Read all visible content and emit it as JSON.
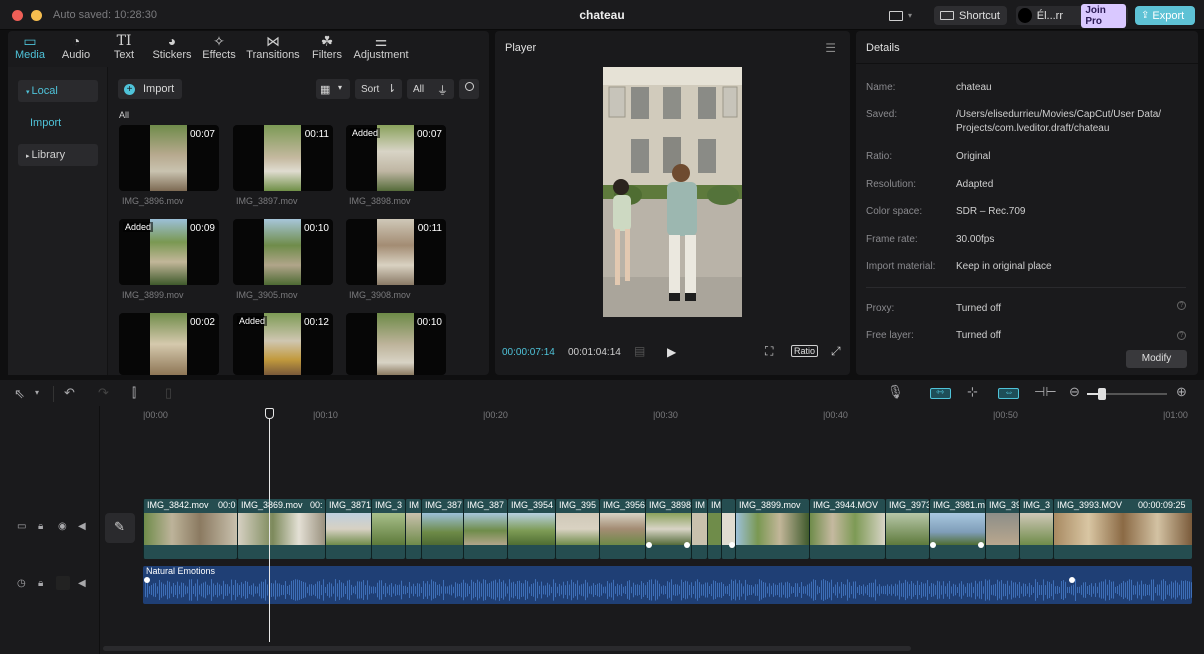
{
  "titlebar": {
    "autosave": "Auto saved: 10:28:30",
    "project": "chateau",
    "shortcut": "Shortcut",
    "account": "Él...rr",
    "join_pro": "Join Pro",
    "export": "Export"
  },
  "media_tabs": [
    {
      "label": "Media",
      "icon": "media-icon"
    },
    {
      "label": "Audio",
      "icon": "audio-icon"
    },
    {
      "label": "Text",
      "icon": "text-icon"
    },
    {
      "label": "Stickers",
      "icon": "stickers-icon"
    },
    {
      "label": "Effects",
      "icon": "effects-icon"
    },
    {
      "label": "Transitions",
      "icon": "transitions-icon"
    },
    {
      "label": "Filters",
      "icon": "filters-icon"
    },
    {
      "label": "Adjustment",
      "icon": "adjustment-icon"
    }
  ],
  "sidebar": {
    "local": "Local",
    "import": "Import",
    "library": "Library"
  },
  "media": {
    "import_label": "Import",
    "sort_label": "Sort",
    "all_filter": "All",
    "section_all": "All",
    "items": [
      {
        "name": "IMG_3896.mov",
        "duration": "00:07",
        "added": ""
      },
      {
        "name": "IMG_3897.mov",
        "duration": "00:11",
        "added": ""
      },
      {
        "name": "IMG_3898.mov",
        "duration": "00:07",
        "added": "Added"
      },
      {
        "name": "IMG_3899.mov",
        "duration": "00:09",
        "added": "Added"
      },
      {
        "name": "IMG_3905.mov",
        "duration": "00:10",
        "added": ""
      },
      {
        "name": "IMG_3908.mov",
        "duration": "00:11",
        "added": ""
      },
      {
        "name": "",
        "duration": "00:02",
        "added": ""
      },
      {
        "name": "",
        "duration": "00:12",
        "added": "Added"
      },
      {
        "name": "",
        "duration": "00:10",
        "added": ""
      }
    ]
  },
  "player": {
    "title": "Player",
    "current_time": "00:00:07:14",
    "total_time": "00:01:04:14",
    "ratio_label": "Ratio"
  },
  "details": {
    "title": "Details",
    "rows": [
      {
        "label": "Name:",
        "value": "chateau"
      },
      {
        "label": "Saved:",
        "value": "/Users/elisedurrieu/Movies/CapCut/User Data/"
      },
      {
        "label": "",
        "value": "Projects/com.lveditor.draft/chateau"
      },
      {
        "label": "Ratio:",
        "value": "Original"
      },
      {
        "label": "Resolution:",
        "value": "Adapted"
      },
      {
        "label": "Color space:",
        "value": "SDR – Rec.709"
      },
      {
        "label": "Frame rate:",
        "value": "30.00fps"
      },
      {
        "label": "Import material:",
        "value": "Keep in original place"
      },
      {
        "label": "Proxy:",
        "value": "Turned off"
      },
      {
        "label": "Free layer:",
        "value": "Turned off"
      }
    ],
    "modify": "Modify"
  },
  "timeline": {
    "ruler": [
      "|00:00",
      "|00:10",
      "|00:20",
      "|00:30",
      "|00:40",
      "|00:50",
      "|01:00"
    ],
    "clips": [
      {
        "name": "IMG_3842.mov",
        "extra": "00:0"
      },
      {
        "name": "IMG_3869.mov",
        "extra": "00:"
      },
      {
        "name": "IMG_3871",
        "extra": ""
      },
      {
        "name": "IMG_3",
        "extra": ""
      },
      {
        "name": "IM",
        "extra": ""
      },
      {
        "name": "IMG_387",
        "extra": ""
      },
      {
        "name": "IMG_387",
        "extra": ""
      },
      {
        "name": "IMG_3954",
        "extra": ""
      },
      {
        "name": "IMG_395",
        "extra": ""
      },
      {
        "name": "IMG_3956",
        "extra": ""
      },
      {
        "name": "IMG_3898",
        "extra": ""
      },
      {
        "name": "IM",
        "extra": ""
      },
      {
        "name": "IM",
        "extra": ""
      },
      {
        "name": "",
        "extra": ""
      },
      {
        "name": "IMG_3899.mov",
        "extra": ""
      },
      {
        "name": "IMG_3944.MOV",
        "extra": ""
      },
      {
        "name": "IMG_3973",
        "extra": ""
      },
      {
        "name": "IMG_3981.m",
        "extra": ""
      },
      {
        "name": "IMG_39",
        "extra": ""
      },
      {
        "name": "IMG_3",
        "extra": ""
      },
      {
        "name": "IMG_3993.MOV",
        "extra": "00:00:09:25"
      }
    ],
    "audio_track": "Natural Emotions"
  }
}
